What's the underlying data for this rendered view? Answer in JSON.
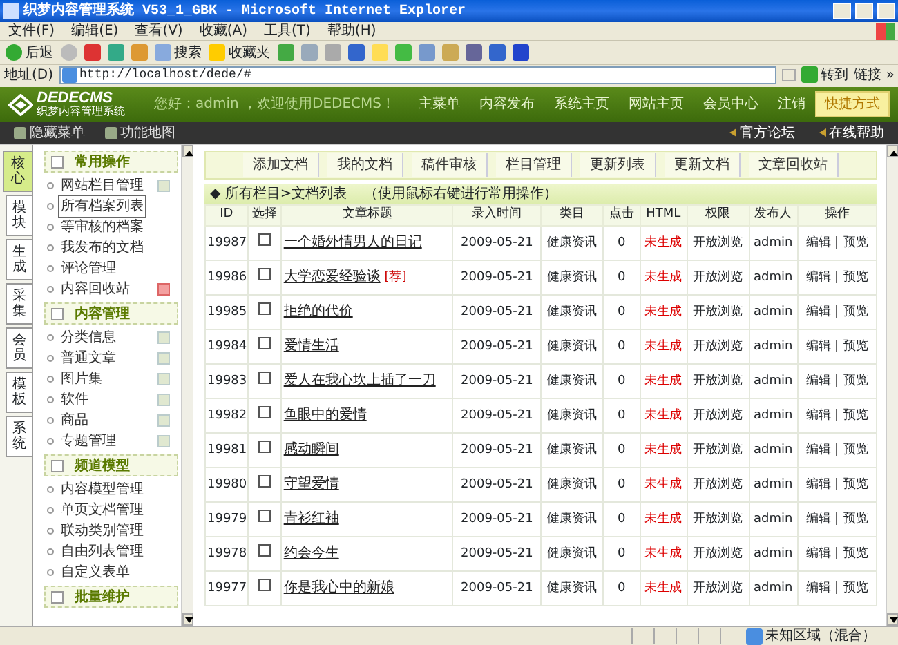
{
  "window": {
    "title": "织梦内容管理系统 V53_1_GBK - Microsoft Internet Explorer"
  },
  "menu_bar": [
    "文件(F)",
    "编辑(E)",
    "查看(V)",
    "收藏(A)",
    "工具(T)",
    "帮助(H)"
  ],
  "toolbar": {
    "back": "后退",
    "search": "搜索",
    "favorites": "收藏夹"
  },
  "address_bar": {
    "label": "地址(D)",
    "url": "http://localhost/dede/#",
    "go": "转到",
    "links": "链接 »"
  },
  "header": {
    "logo_title": "DEDECMS",
    "logo_subtitle": "织梦内容管理系统",
    "greeting": "您好：admin ，欢迎使用DEDECMS！",
    "nav": [
      "主菜单",
      "内容发布",
      "系统主页",
      "网站主页",
      "会员中心",
      "注销"
    ],
    "shortcut": "快捷方式"
  },
  "subbar": {
    "left": [
      "隐藏菜单",
      "功能地图"
    ],
    "right": [
      "官方论坛",
      "在线帮助"
    ]
  },
  "side_tabs": [
    {
      "label": "核心",
      "selected": true
    },
    {
      "label": "模块",
      "selected": false
    },
    {
      "label": "生成",
      "selected": false
    },
    {
      "label": "采集",
      "selected": false
    },
    {
      "label": "会员",
      "selected": false
    },
    {
      "label": "模板",
      "selected": false
    },
    {
      "label": "系统",
      "selected": false
    }
  ],
  "sidebar": [
    {
      "title": "常用操作",
      "items": [
        {
          "label": "网站栏目管理",
          "selected": false,
          "kind": "add"
        },
        {
          "label": "所有档案列表",
          "selected": true
        },
        {
          "label": "等审核的档案",
          "selected": false
        },
        {
          "label": "我发布的文档",
          "selected": false
        },
        {
          "label": "评论管理",
          "selected": false
        },
        {
          "label": "内容回收站",
          "selected": false,
          "kind": "delete"
        }
      ]
    },
    {
      "title": "内容管理",
      "items": [
        {
          "label": "分类信息",
          "selected": false,
          "kind": "add"
        },
        {
          "label": "普通文章",
          "selected": false,
          "kind": "add"
        },
        {
          "label": "图片集",
          "selected": false,
          "kind": "add"
        },
        {
          "label": "软件",
          "selected": false,
          "kind": "add"
        },
        {
          "label": "商品",
          "selected": false,
          "kind": "add"
        },
        {
          "label": "专题管理",
          "selected": false,
          "kind": "add"
        }
      ]
    },
    {
      "title": "频道模型",
      "items": [
        {
          "label": "内容模型管理",
          "selected": false
        },
        {
          "label": "单页文档管理",
          "selected": false
        },
        {
          "label": "联动类别管理",
          "selected": false
        },
        {
          "label": "自由列表管理",
          "selected": false
        },
        {
          "label": "自定义表单",
          "selected": false
        }
      ]
    },
    {
      "title": "批量维护"
    }
  ],
  "content": {
    "buttons": [
      "添加文档",
      "我的文档",
      "稿件审核",
      "栏目管理",
      "更新列表",
      "更新文档",
      "文章回收站"
    ],
    "breadcrumb": "◆ 所有栏目>文档列表",
    "hint": "（使用鼠标右键进行常用操作）",
    "columns": [
      "ID",
      "选择",
      "文章标题",
      "录入时间",
      "类目",
      "点击",
      "HTML",
      "权限",
      "发布人",
      "操作"
    ],
    "rows": [
      {
        "id": "19987",
        "checked": false,
        "title": "一个婚外情男人的日记",
        "date": "2009-05-21",
        "category": "健康资讯",
        "clicks": "0",
        "html": "未生成",
        "permission": "开放浏览",
        "author": "admin",
        "edit": "编辑",
        "preview": "预览"
      },
      {
        "id": "19986",
        "checked": false,
        "title": "大学恋爱经验谈",
        "flag": "[荐]",
        "date": "2009-05-21",
        "category": "健康资讯",
        "clicks": "0",
        "html": "未生成",
        "permission": "开放浏览",
        "author": "admin",
        "edit": "编辑",
        "preview": "预览"
      },
      {
        "id": "19985",
        "checked": false,
        "title": "拒绝的代价",
        "date": "2009-05-21",
        "category": "健康资讯",
        "clicks": "0",
        "html": "未生成",
        "permission": "开放浏览",
        "author": "admin",
        "edit": "编辑",
        "preview": "预览"
      },
      {
        "id": "19984",
        "checked": false,
        "title": "爱情生活",
        "date": "2009-05-21",
        "category": "健康资讯",
        "clicks": "0",
        "html": "未生成",
        "permission": "开放浏览",
        "author": "admin",
        "edit": "编辑",
        "preview": "预览"
      },
      {
        "id": "19983",
        "checked": false,
        "title": "爱人在我心坎上插了一刀",
        "date": "2009-05-21",
        "category": "健康资讯",
        "clicks": "0",
        "html": "未生成",
        "permission": "开放浏览",
        "author": "admin",
        "edit": "编辑",
        "preview": "预览"
      },
      {
        "id": "19982",
        "checked": false,
        "title": "鱼眼中的爱情",
        "date": "2009-05-21",
        "category": "健康资讯",
        "clicks": "0",
        "html": "未生成",
        "permission": "开放浏览",
        "author": "admin",
        "edit": "编辑",
        "preview": "预览"
      },
      {
        "id": "19981",
        "checked": false,
        "title": "感动瞬间",
        "date": "2009-05-21",
        "category": "健康资讯",
        "clicks": "0",
        "html": "未生成",
        "permission": "开放浏览",
        "author": "admin",
        "edit": "编辑",
        "preview": "预览"
      },
      {
        "id": "19980",
        "checked": false,
        "title": "守望爱情",
        "date": "2009-05-21",
        "category": "健康资讯",
        "clicks": "0",
        "html": "未生成",
        "permission": "开放浏览",
        "author": "admin",
        "edit": "编辑",
        "preview": "预览"
      },
      {
        "id": "19979",
        "checked": false,
        "title": "青衫红袖",
        "date": "2009-05-21",
        "category": "健康资讯",
        "clicks": "0",
        "html": "未生成",
        "permission": "开放浏览",
        "author": "admin",
        "edit": "编辑",
        "preview": "预览"
      },
      {
        "id": "19978",
        "checked": false,
        "title": "约会今生",
        "date": "2009-05-21",
        "category": "健康资讯",
        "clicks": "0",
        "html": "未生成",
        "permission": "开放浏览",
        "author": "admin",
        "edit": "编辑",
        "preview": "预览"
      },
      {
        "id": "19977",
        "checked": false,
        "title": "你是我心中的新娘",
        "date": "2009-05-21",
        "category": "健康资讯",
        "clicks": "0",
        "html": "未生成",
        "permission": "开放浏览",
        "author": "admin",
        "edit": "编辑",
        "preview": "预览"
      }
    ]
  },
  "status_bar": {
    "zone": "未知区域（混合）"
  }
}
